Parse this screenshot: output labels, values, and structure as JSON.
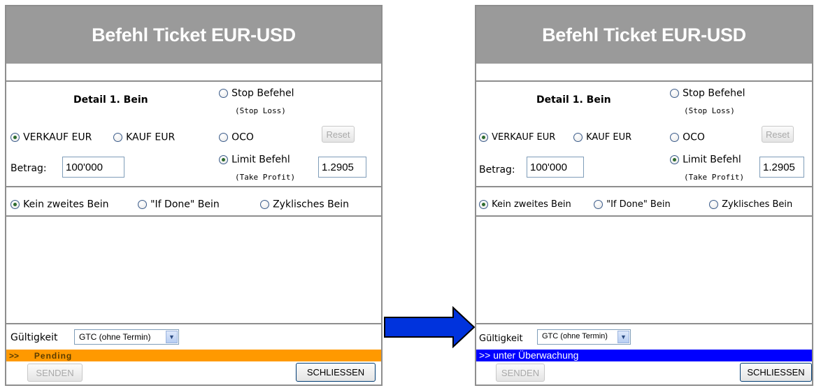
{
  "left": {
    "title": "Befehl Ticket EUR-USD",
    "detail_heading": "Detail 1. Bein",
    "stop_label": "Stop Befehel",
    "stop_sub": "(Stop Loss)",
    "sell_label": "VERKAUF EUR",
    "buy_label": "KAUF EUR",
    "oco_label": "OCO",
    "reset_label": "Reset",
    "betrag_label": "Betrag:",
    "betrag_value": "100'000",
    "limit_label": "Limit Befehl",
    "limit_sub": "(Take Profit)",
    "limit_value": "1.2905",
    "leg_none": "Kein zweites Bein",
    "leg_ifdone": "\"If Done\" Bein",
    "leg_cyclic": "Zyklisches Bein",
    "validity_label": "Gültigkeit",
    "validity_value": "GTC (ohne Termin)",
    "status_prefix": ">>",
    "status_text": "Pending",
    "status_color": "#ff9900",
    "send_label": "SENDEN",
    "close_label": "SCHLIESSEN"
  },
  "right": {
    "title": "Befehl Ticket EUR-USD",
    "detail_heading": "Detail 1. Bein",
    "stop_label": "Stop Befehel",
    "stop_sub": "(Stop Loss)",
    "sell_label": "VERKAUF EUR",
    "buy_label": "KAUF EUR",
    "oco_label": "OCO",
    "reset_label": "Reset",
    "betrag_label": "Betrag:",
    "betrag_value": "100'000",
    "limit_label": "Limit Befehl",
    "limit_sub": "(Take Profit)",
    "limit_value": "1.2905",
    "leg_none": "Kein zweites Bein",
    "leg_ifdone": "\"If Done\" Bein",
    "leg_cyclic": "Zyklisches Bein",
    "validity_label": "Gültigkeit",
    "validity_value": "GTC (ohne Termin)",
    "status_text": ">> unter Überwachung",
    "status_color": "#0000ff",
    "send_label": "SENDEN",
    "close_label": "SCHLIESSEN"
  },
  "arrow": {
    "icon": "arrow-right-icon",
    "color": "#0033dd"
  }
}
